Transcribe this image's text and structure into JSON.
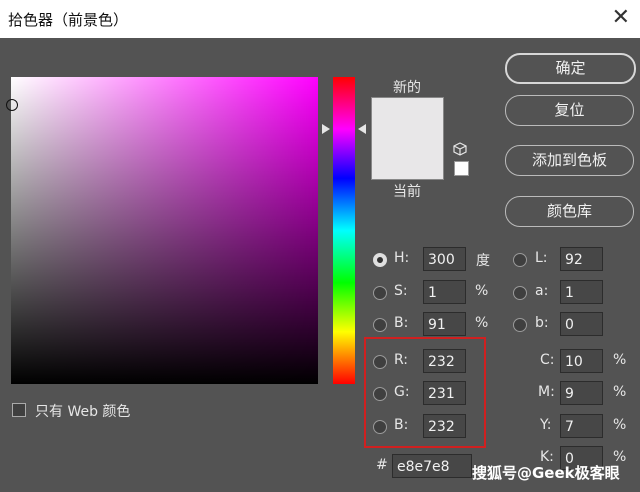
{
  "window": {
    "title": "拾色器（前景色）",
    "close_glyph": "✕"
  },
  "preview": {
    "new_label": "新的",
    "current_label": "当前",
    "new_color": "#e8e7e8",
    "current_color": "#e8e7e8"
  },
  "buttons": {
    "ok": "确定",
    "reset": "复位",
    "add_to_swatches": "添加到色板",
    "color_libraries": "颜色库"
  },
  "hsb": {
    "h": {
      "label": "H:",
      "value": "300",
      "unit": "度",
      "selected": true
    },
    "s": {
      "label": "S:",
      "value": "1",
      "unit": "%"
    },
    "b": {
      "label": "B:",
      "value": "91",
      "unit": "%"
    }
  },
  "lab": {
    "l": {
      "label": "L:",
      "value": "92"
    },
    "a": {
      "label": "a:",
      "value": "1"
    },
    "b": {
      "label": "b:",
      "value": "0"
    }
  },
  "rgb": {
    "r": {
      "label": "R:",
      "value": "232"
    },
    "g": {
      "label": "G:",
      "value": "231"
    },
    "b": {
      "label": "B:",
      "value": "232"
    }
  },
  "cmyk": {
    "c": {
      "label": "C:",
      "value": "10",
      "unit": "%"
    },
    "m": {
      "label": "M:",
      "value": "9",
      "unit": "%"
    },
    "y": {
      "label": "Y:",
      "value": "7",
      "unit": "%"
    },
    "k": {
      "label": "K:",
      "value": "0",
      "unit": "%"
    }
  },
  "hex": {
    "label": "#",
    "value": "e8e7e8"
  },
  "web_only": {
    "label": "只有 Web 颜色",
    "checked": false
  },
  "watermark": "搜狐号@Geek极客眼",
  "colors": {
    "hue_base": "#ff00ff",
    "highlight": "#d02020",
    "dialog_bg": "#535353"
  }
}
